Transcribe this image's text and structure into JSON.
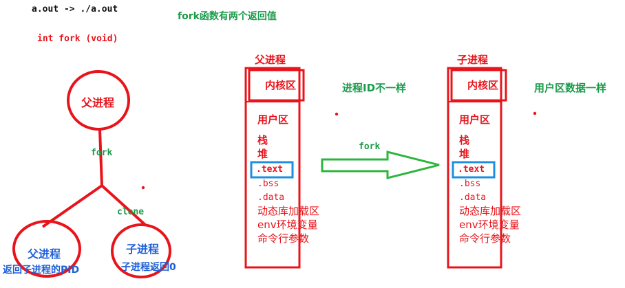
{
  "header": {
    "aout_line": "a.out  ->  ./a.out",
    "fork_signature": "int fork (void)",
    "fork_returns": "fork函数有两个返回值"
  },
  "tree": {
    "parent_label": "父进程",
    "fork_label": "fork",
    "clone_label": "clone",
    "child_parent_label": "父进程",
    "child_parent_caption": "返回子进程的PID",
    "child_label": "子进程",
    "child_caption": "子进程返回0"
  },
  "left_memory": {
    "title": "父进程",
    "kernel": "内核区",
    "user": "用户区",
    "stack": "栈",
    "heap": "堆",
    "text": ".text",
    "bss": ".bss",
    "data": ".data",
    "dynlib": "动态库加载区",
    "env": "env环境变量",
    "args": "命令行参数"
  },
  "right_memory": {
    "title": "子进程",
    "kernel": "内核区",
    "user": "用户区",
    "stack": "栈",
    "heap": "堆",
    "text": ".text",
    "bss": ".bss",
    "data": ".data",
    "dynlib": "动态库加载区",
    "env": "env环境变量",
    "args": "命令行参数"
  },
  "notes": {
    "pid_differs": "进程ID不一样",
    "user_same": "用户区数据一样",
    "arrow_label": "fork"
  },
  "colors": {
    "red": "#e8141b",
    "green": "#1a9b4a",
    "blue": "#1e5fd6",
    "arrow_green": "#2db53c"
  }
}
